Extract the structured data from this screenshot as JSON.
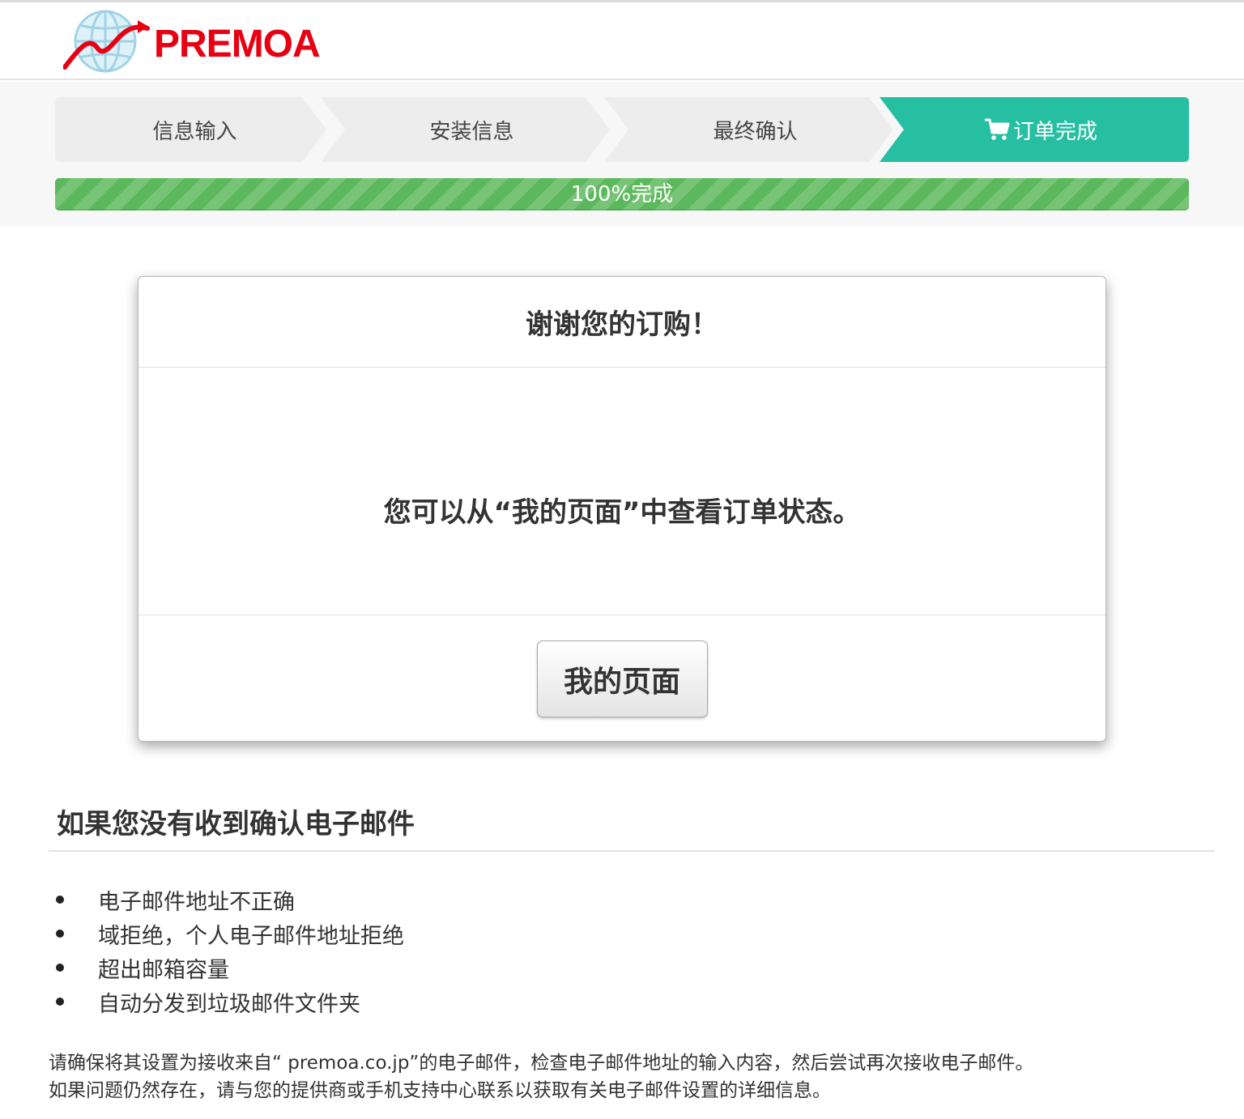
{
  "brand": {
    "name": "PREMOA"
  },
  "steps": [
    {
      "label": "信息输入",
      "state": "done"
    },
    {
      "label": "安装信息",
      "state": "done"
    },
    {
      "label": "最终确认",
      "state": "done"
    },
    {
      "label": "订单完成",
      "state": "active",
      "icon": "cart-icon"
    }
  ],
  "progress": {
    "percent": 100,
    "label": "100%完成"
  },
  "modal": {
    "title": "谢谢您的订购！",
    "message": "您可以从“我的页面”中查看订单状态。",
    "button_label": "我的页面"
  },
  "email_help": {
    "title": "如果您没有收到确认电子邮件",
    "reasons": [
      "电子邮件地址不正确",
      "域拒绝，个人电子邮件地址拒绝",
      "超出邮箱容量",
      "自动分发到垃圾邮件文件夹"
    ],
    "note_lines": [
      "请确保将其设置为接收来自“ premoa.co.jp”的电子邮件，检查电子邮件地址的输入内容，然后尝试再次接收电子邮件。",
      "如果问题仍然存在，请与您的提供商或手机支持中心联系以获取有关电子邮件设置的详细信息。"
    ]
  },
  "colors": {
    "brand_red": "#e60012",
    "step_active": "#26bfa1",
    "step_inactive": "#ededed",
    "progress_green": "#5cb85c"
  }
}
